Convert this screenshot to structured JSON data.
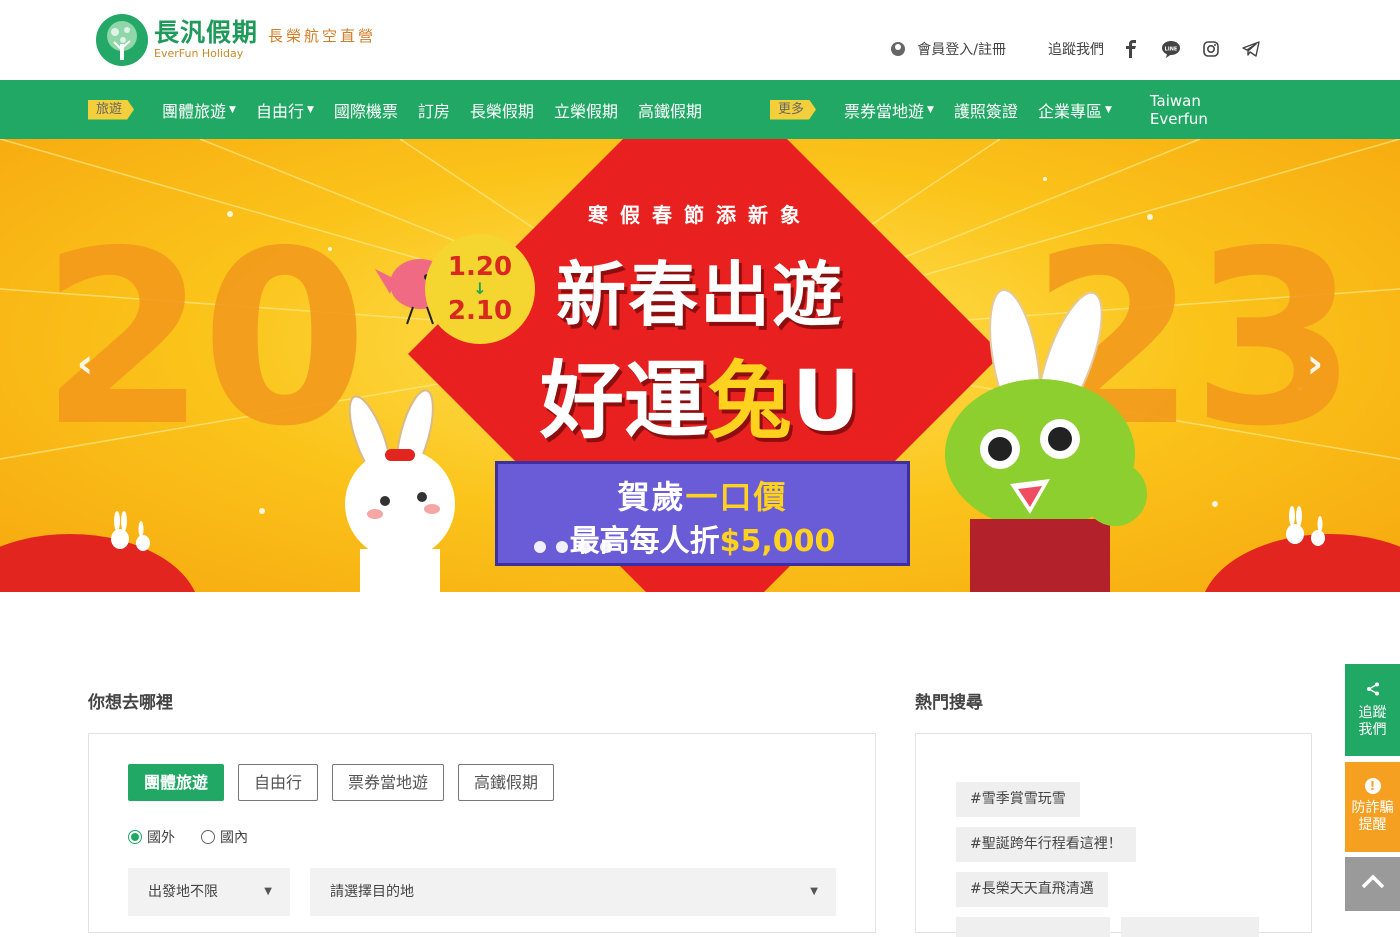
{
  "header": {
    "logo_zh": "長汎假期",
    "logo_en": "EverFun Holiday",
    "logo_tag": "長榮航空直營",
    "member_label": "會員登入/註冊",
    "follow_label": "追蹤我們",
    "social_icons": [
      "facebook-icon",
      "line-icon",
      "instagram-icon",
      "telegram-icon"
    ]
  },
  "nav": {
    "tag_travel": "旅遊",
    "items_left": [
      {
        "label": "團體旅遊",
        "caret": true
      },
      {
        "label": "自由行",
        "caret": true
      },
      {
        "label": "國際機票",
        "caret": false
      },
      {
        "label": "訂房",
        "caret": false
      },
      {
        "label": "長榮假期",
        "caret": false
      },
      {
        "label": "立榮假期",
        "caret": false
      },
      {
        "label": "高鐵假期",
        "caret": false
      }
    ],
    "tag_more": "更多",
    "items_right": [
      {
        "label": "票券當地遊",
        "caret": true
      },
      {
        "label": "護照簽證",
        "caret": false
      },
      {
        "label": "企業專區",
        "caret": true
      }
    ],
    "taiwan_line1": "Taiwan",
    "taiwan_line2": "Everfun"
  },
  "banner": {
    "year_left": "20",
    "year_right": "23",
    "kicker": "寒假春節添新象",
    "title1": "新春出遊",
    "title2_a": "好運",
    "title2_hl": "兔",
    "title2_b": "U",
    "date_start": "1.20",
    "date_arrow": "↓",
    "date_end": "2.10",
    "scroll_a": "賀歲",
    "scroll_hl": "一口價",
    "scroll2_a": "最高每人折",
    "scroll2_hl": "$5,000",
    "slide_count": 4,
    "arrow_prev": "‹",
    "arrow_next": "›"
  },
  "search": {
    "title": "你想去哪裡",
    "tabs": [
      "團體旅遊",
      "自由行",
      "票券當地遊",
      "高鐵假期"
    ],
    "active_tab": 0,
    "radio_abroad": "國外",
    "radio_domestic": "國內",
    "origin_value": "出發地不限",
    "destination_placeholder": "請選擇目的地"
  },
  "hot": {
    "title": "熱門搜尋",
    "tags": [
      "#雪季賞雪玩雪",
      "#聖誕跨年行程看這裡！",
      "#長榮天天直飛清邁"
    ]
  },
  "float": {
    "follow_l1": "追蹤",
    "follow_l2": "我們",
    "fraud_l1": "防詐騙",
    "fraud_l2": "提醒",
    "top_icon": "chevron-up-icon"
  },
  "colors": {
    "brand_green": "#22a865",
    "tag_yellow": "#f3d03b",
    "banner_red": "#e8201f",
    "fraud_orange": "#f5a021"
  }
}
